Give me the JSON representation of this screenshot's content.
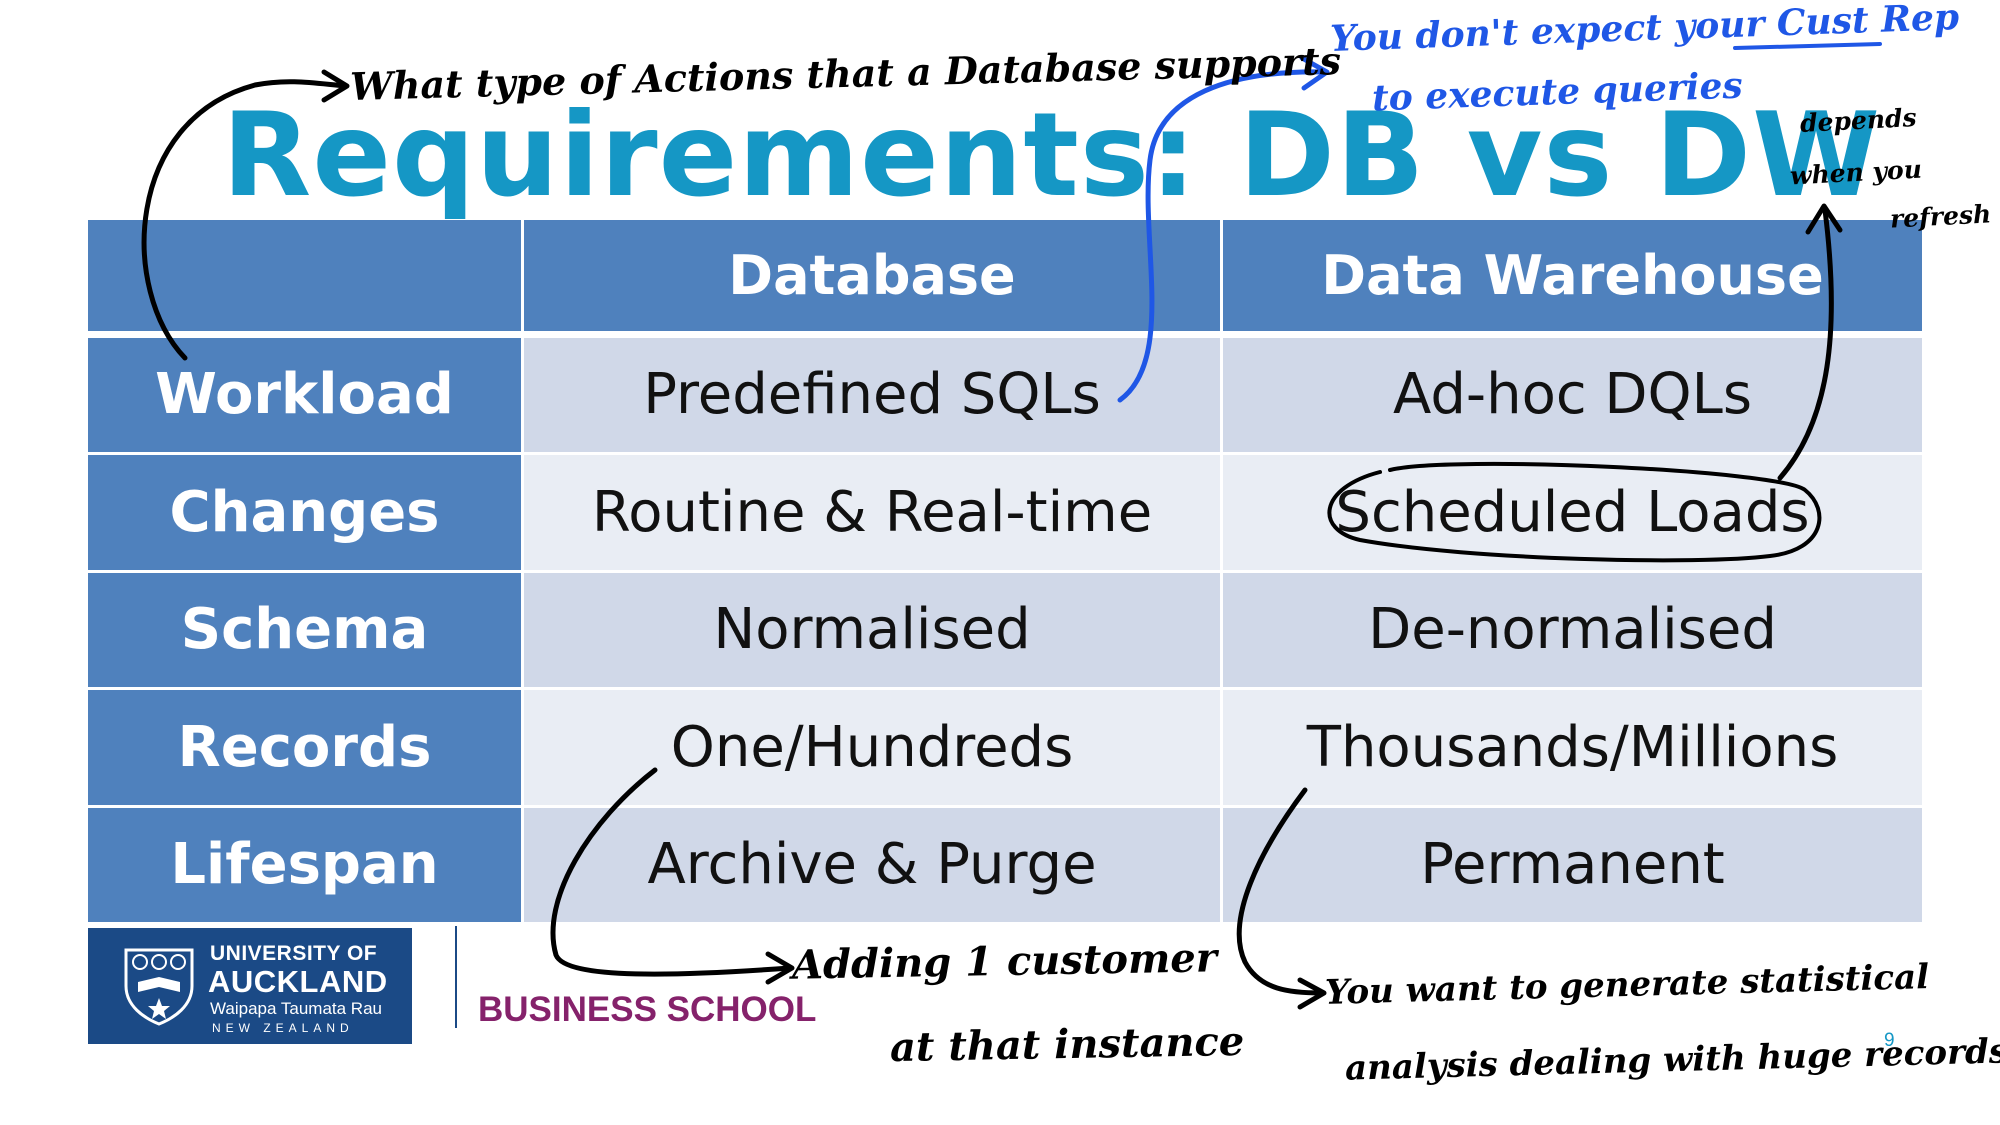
{
  "title": "Requirements: DB vs DW",
  "table": {
    "headers": [
      "",
      "Database",
      "Data Warehouse"
    ],
    "rows": [
      {
        "label": "Workload",
        "database": "Predefined SQLs",
        "warehouse": "Ad-hoc DQLs"
      },
      {
        "label": "Changes",
        "database": "Routine & Real-time",
        "warehouse": "Scheduled Loads"
      },
      {
        "label": "Schema",
        "database": "Normalised",
        "warehouse": "De-normalised"
      },
      {
        "label": "Records",
        "database": "One/Hundreds",
        "warehouse": "Thousands/Millions"
      },
      {
        "label": "Lifespan",
        "database": "Archive & Purge",
        "warehouse": "Permanent"
      }
    ]
  },
  "logo": {
    "line1": "UNIVERSITY OF",
    "line2": "AUCKLAND",
    "line3": "Waipapa Taumata Rau",
    "line4": "NEW ZEALAND",
    "school": "BUSINESS SCHOOL"
  },
  "page_number": "9",
  "annotations": {
    "actions": "What type of Actions that a Database supports",
    "cust_rep_1": "You don't expect your Cust Rep",
    "cust_rep_2": "to execute queries",
    "refresh_1": "depends",
    "refresh_2": "when you",
    "refresh_3": "refresh",
    "adding_1": "Adding 1 customer",
    "adding_2": "at that instance",
    "stats_1": "You want to generate statistical",
    "stats_2": "analysis dealing with huge records"
  },
  "colors": {
    "title": "#1597c5",
    "header_fill": "#4f81bd",
    "row_odd": "#d0d8e8",
    "row_even": "#e9edf4",
    "ink_black": "#000000",
    "ink_blue": "#1f57e6",
    "logo_blue": "#1b4a86",
    "school_purple": "#85226b"
  }
}
